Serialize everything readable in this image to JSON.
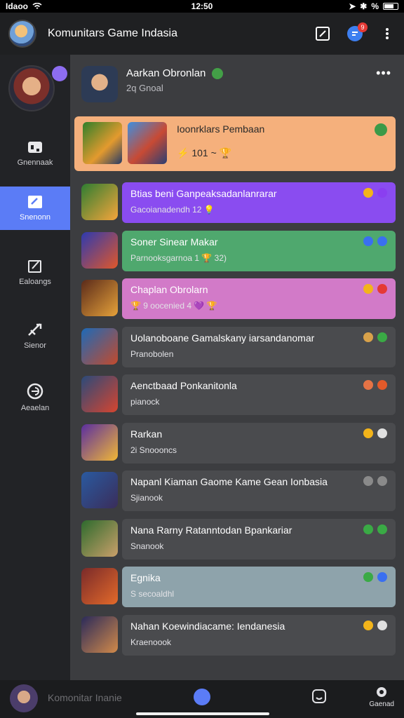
{
  "status": {
    "carrier": "Idaoo",
    "time": "12:50",
    "battery": "%"
  },
  "top_bar": {
    "title": "Komunitars Game Indasia",
    "badge": "9"
  },
  "sidebar": {
    "items": [
      {
        "label": "Gnennaak",
        "icon": "gamepad-icon"
      },
      {
        "label": "Snenonn",
        "icon": "edit-icon"
      },
      {
        "label": "Ealoangs",
        "icon": "edit-square-icon"
      },
      {
        "label": "Sienor",
        "icon": "sword-icon"
      },
      {
        "label": "Aeaelan",
        "icon": "discord-icon"
      }
    ]
  },
  "header_card": {
    "name": "Aarkan Obronlan",
    "sub": "2q Gnoal"
  },
  "featured": {
    "title": "Ioonrklars Pembaan",
    "meta": "⚡ 101 ~ 🏆"
  },
  "rows": [
    {
      "title": "Btias beni Ganpeaksadanlanrarar",
      "sub": "Gacoianadendh 12 💡",
      "color": "#8a4cf0",
      "i1": "#f3b41a",
      "i2": "#8a3ff0"
    },
    {
      "title": "Soner Sinear Makar",
      "sub": "Parnooksgarnoa 1 🏆 32)",
      "color": "#4fa86e",
      "i1": "#3a6ff0",
      "i2": "#3a6ff0"
    },
    {
      "title": "Chaplan Obrolarn",
      "sub": "🏆 9 oocenied 4 💜 🏆",
      "color": "#d27ac8",
      "i1": "#f3b41a",
      "i2": "#e53935"
    },
    {
      "title": "Uolanoboane Gamalskany iarsandanomar",
      "sub": "Pranobolen",
      "color": "#4a4b4e",
      "i1": "#d9a24a",
      "i2": "#3aaa45"
    },
    {
      "title": "Aenctbaad Ponkanitonla",
      "sub": "pianock",
      "color": "#4a4b4e",
      "i1": "#e57345",
      "i2": "#e35a2a"
    },
    {
      "title": "Rarkan",
      "sub": "2i Snoooncs",
      "color": "#4a4b4e",
      "i1": "#f3b41a",
      "i2": "#e0e0e0"
    },
    {
      "title": "Napanl Kiaman Gaome Kame Gean Ionbasia",
      "sub": "Sjianook",
      "color": "#4a4b4e",
      "i1": "#8a8a8a",
      "i2": "#8a8a8a"
    },
    {
      "title": "Nana Rarny Ratanntodan Bpankariar",
      "sub": "Snanook",
      "color": "#4a4b4e",
      "i1": "#3aaa45",
      "i2": "#3aaa45"
    },
    {
      "title": "Egnika",
      "sub": "S secoaldhl",
      "color": "#8ea3ab",
      "i1": "#3aaa45",
      "i2": "#3a6ff0"
    },
    {
      "title": "Nahan Koewindiacame: Iendanesia",
      "sub": "Kraenoook",
      "color": "#4a4b4e",
      "i1": "#f3b41a",
      "i2": "#e0e0e0"
    }
  ],
  "bottom_bar": {
    "label": "Komonitar Inanie",
    "right_label": "Gaenad"
  }
}
